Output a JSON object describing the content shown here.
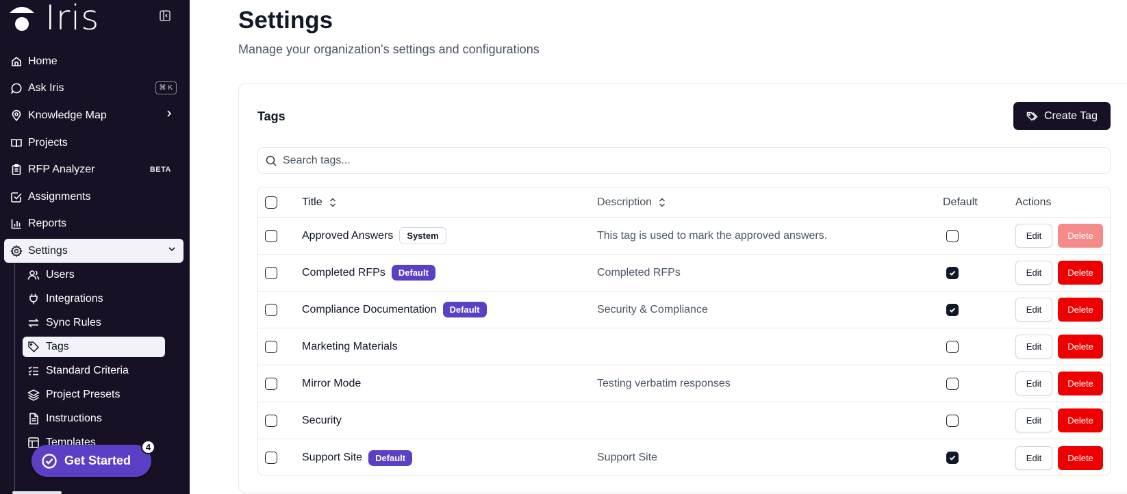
{
  "sidebar": {
    "logo_text": "Iris",
    "nav": [
      {
        "label": "Home",
        "icon": "home-icon"
      },
      {
        "label": "Ask Iris",
        "icon": "chat-bubble-icon",
        "shortcut": "⌘ K"
      },
      {
        "label": "Knowledge Map",
        "icon": "map-pin-icon"
      },
      {
        "label": "Projects",
        "icon": "book-open-icon"
      },
      {
        "label": "RFP Analyzer",
        "icon": "clipboard-icon",
        "badge": "BETA"
      },
      {
        "label": "Assignments",
        "icon": "check-square-icon"
      },
      {
        "label": "Reports",
        "icon": "bar-chart-icon"
      },
      {
        "label": "Settings",
        "icon": "gear-icon"
      }
    ],
    "settings_sub": [
      {
        "label": "Users",
        "icon": "users-icon"
      },
      {
        "label": "Integrations",
        "icon": "plug-icon"
      },
      {
        "label": "Sync Rules",
        "icon": "arrows-swap-icon"
      },
      {
        "label": "Tags",
        "icon": "tag-icon"
      },
      {
        "label": "Standard Criteria",
        "icon": "list-checks-icon"
      },
      {
        "label": "Project Presets",
        "icon": "layers-icon"
      },
      {
        "label": "Instructions",
        "icon": "document-icon"
      },
      {
        "label": "Templates",
        "icon": "layout-icon"
      }
    ],
    "get_started": {
      "label": "Get Started",
      "count": "4"
    }
  },
  "page": {
    "title": "Settings",
    "subtitle": "Manage your organization's settings and configurations"
  },
  "tags_card": {
    "title": "Tags",
    "create_button": "Create Tag",
    "search_placeholder": "Search tags...",
    "columns": {
      "title": "Title",
      "description": "Description",
      "default": "Default",
      "actions": "Actions"
    },
    "edit_label": "Edit",
    "delete_label": "Delete",
    "rows": [
      {
        "title": "Approved Answers",
        "badge": "System",
        "description": "This tag is used to mark the approved answers.",
        "default": false,
        "delete_disabled": true
      },
      {
        "title": "Completed RFPs",
        "badge": "Default",
        "description": "Completed RFPs",
        "default": true,
        "delete_disabled": false
      },
      {
        "title": "Compliance Documentation",
        "badge": "Default",
        "description": "Security & Compliance",
        "default": true,
        "delete_disabled": false
      },
      {
        "title": "Marketing Materials",
        "badge": "",
        "description": "",
        "default": false,
        "delete_disabled": false
      },
      {
        "title": "Mirror Mode",
        "badge": "",
        "description": "Testing verbatim responses",
        "default": false,
        "delete_disabled": false
      },
      {
        "title": "Security",
        "badge": "",
        "description": "",
        "default": false,
        "delete_disabled": false
      },
      {
        "title": "Support Site",
        "badge": "Default",
        "description": "Support Site",
        "default": true,
        "delete_disabled": false
      }
    ]
  },
  "colors": {
    "sidebar_bg": "#181126",
    "accent_purple": "#5b3fc4",
    "delete_red": "#ef0000",
    "primary_dark": "#181126"
  }
}
